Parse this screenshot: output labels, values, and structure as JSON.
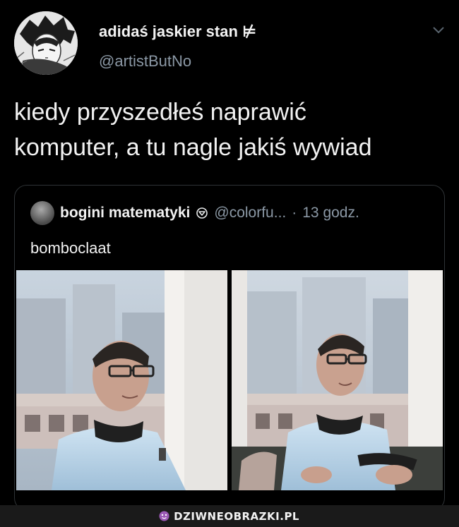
{
  "tweet": {
    "author_name": "adidaś jaskier stan ⊭",
    "author_handle": "@artistButNo",
    "text_lines": [
      "kiedy przyszedłeś naprawić",
      "komputer, a tu nagle jakiś wywiad"
    ],
    "icons": {
      "avatar": "anime-portrait-avatar",
      "menu": "chevron-down-icon"
    }
  },
  "quoted_tweet": {
    "author_name": "bogini matematyki",
    "badge_icon": "badge-icon",
    "author_handle": "@colorfu...",
    "separator": "·",
    "time": "13 godz.",
    "text": "bomboclaat",
    "media": [
      {
        "description_icon": "photo-frame-left"
      },
      {
        "description_icon": "photo-frame-right"
      }
    ]
  },
  "watermark": {
    "text": "DZIWNEOBRAZKI.PL",
    "logo_icon": "purple-face-icon",
    "color": "#9b59b6"
  },
  "colors": {
    "background": "#000000",
    "text": "#f2f2f2",
    "muted": "#8b98a5",
    "border": "#2f3336"
  }
}
